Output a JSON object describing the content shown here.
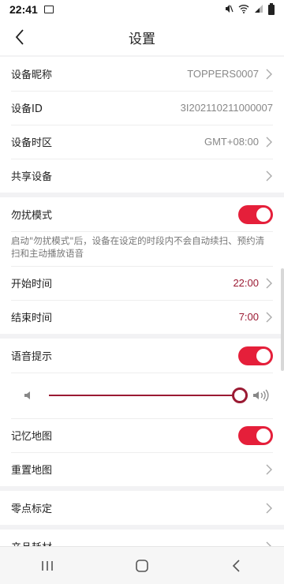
{
  "status_bar": {
    "time": "22:41"
  },
  "header": {
    "title": "设置"
  },
  "device_group": [
    {
      "label": "设备昵称",
      "value": "TOPPERS0007",
      "chevron": true
    },
    {
      "label": "设备ID",
      "value": "3I202110211000007",
      "chevron": false
    },
    {
      "label": "设备时区",
      "value": "GMT+08:00",
      "chevron": true
    },
    {
      "label": "共享设备",
      "value": "",
      "chevron": true
    }
  ],
  "dnd": {
    "label": "勿扰模式",
    "enabled": true,
    "description": "启动\"勿扰模式\"后，设备在设定的时段内不会自动续扫、预约清扫和主动播放语音",
    "start_label": "开始时间",
    "start_value": "22:00",
    "end_label": "结束时间",
    "end_value": "7:00"
  },
  "voice": {
    "label": "语音提示",
    "enabled": true,
    "volume_level": 1.0
  },
  "map_group": {
    "memory_label": "记忆地图",
    "memory_enabled": true,
    "reset_label": "重置地图"
  },
  "zero_calibration": {
    "label": "零点标定"
  },
  "consumables": {
    "label": "产品耗材"
  },
  "colors": {
    "accent": "#e51f3a",
    "time_text": "#9b1a33"
  }
}
